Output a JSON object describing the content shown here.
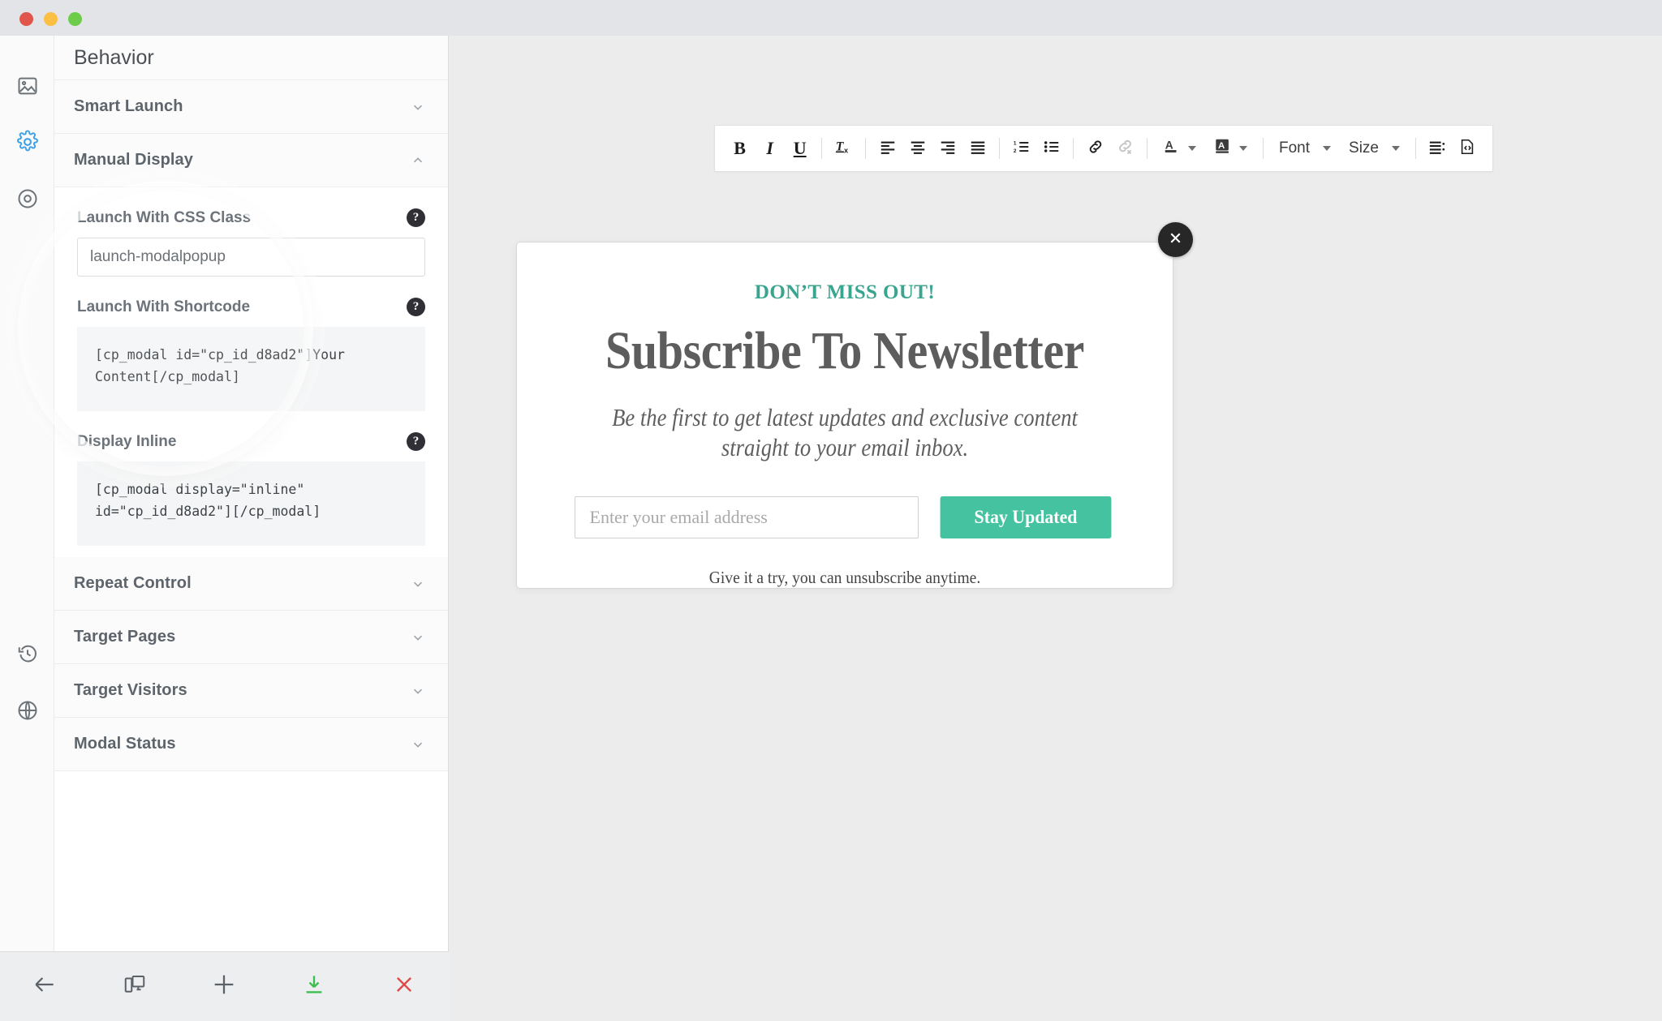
{
  "window": {
    "lights": [
      "close",
      "minimize",
      "maximize"
    ]
  },
  "rail": {
    "items": [
      {
        "name": "image-icon",
        "active": false
      },
      {
        "name": "gear-icon",
        "active": true
      },
      {
        "name": "target-icon",
        "active": false
      },
      {
        "name": "history-icon",
        "active": false
      },
      {
        "name": "globe-icon",
        "active": false
      }
    ]
  },
  "panel": {
    "title": "Behavior",
    "sections": [
      {
        "label": "Smart Launch",
        "expanded": false
      },
      {
        "label": "Manual Display",
        "expanded": true
      },
      {
        "label": "Repeat Control",
        "expanded": false
      },
      {
        "label": "Target Pages",
        "expanded": false
      },
      {
        "label": "Target Visitors",
        "expanded": false
      },
      {
        "label": "Modal Status",
        "expanded": false
      }
    ],
    "manual_display": {
      "css_class": {
        "label": "Launch With CSS Class",
        "value": "launch-modalpopup",
        "help": "?"
      },
      "shortcode": {
        "label": "Launch With Shortcode",
        "code": "[cp_modal id=\"cp_id_d8ad2\"]Your Content[/cp_modal]",
        "help": "?"
      },
      "display_inline": {
        "label": "Display Inline",
        "code": "[cp_modal display=\"inline\" id=\"cp_id_d8ad2\"][/cp_modal]",
        "help": "?"
      }
    }
  },
  "bottom_toolbar": {
    "buttons": [
      {
        "name": "back-arrow-icon",
        "label": "Back"
      },
      {
        "name": "responsive-icon",
        "label": "Responsive Preview"
      },
      {
        "name": "add-icon",
        "label": "Add"
      },
      {
        "name": "save-download-icon",
        "label": "Save"
      },
      {
        "name": "close-icon",
        "label": "Close"
      }
    ]
  },
  "editor_toolbar": {
    "groups": [
      {
        "items": [
          {
            "name": "bold-icon",
            "glyph": "B"
          },
          {
            "name": "italic-icon",
            "glyph": "I"
          },
          {
            "name": "underline-icon",
            "glyph": "U"
          }
        ]
      },
      {
        "items": [
          {
            "name": "remove-format-icon",
            "glyph": "Tx"
          }
        ]
      },
      {
        "items": [
          {
            "name": "align-left-icon",
            "glyph": ""
          },
          {
            "name": "align-center-icon",
            "glyph": ""
          },
          {
            "name": "align-right-icon",
            "glyph": ""
          },
          {
            "name": "align-justify-icon",
            "glyph": ""
          }
        ]
      },
      {
        "items": [
          {
            "name": "numbered-list-icon",
            "glyph": ""
          },
          {
            "name": "bulleted-list-icon",
            "glyph": ""
          }
        ]
      },
      {
        "items": [
          {
            "name": "link-icon",
            "glyph": ""
          },
          {
            "name": "unlink-icon",
            "glyph": "",
            "disabled": true
          }
        ]
      },
      {
        "items": [
          {
            "name": "text-color-icon",
            "glyph": "A"
          },
          {
            "name": "bg-color-icon",
            "glyph": "A"
          }
        ]
      }
    ],
    "font_dropdown": "Font",
    "size_dropdown": "Size",
    "line_height_icon": "line-height-icon",
    "source_code_icon": "source-code-icon"
  },
  "popup": {
    "close_label": "×",
    "eyebrow": "DON’T MISS OUT!",
    "heading": "Subscribe To Newsletter",
    "subheading": "Be the first to get latest updates and exclusive content straight to your email inbox.",
    "email_placeholder": "Enter your email address",
    "email_value": "",
    "cta_label": "Stay Updated",
    "note": "Give it a try, you can unsubscribe anytime."
  },
  "colors": {
    "accent_teal": "#3aa58e",
    "cta_green": "#45c2a0",
    "rail_active": "#3aa0e8",
    "save_green": "#3cbf4f",
    "close_red": "#e04747"
  }
}
